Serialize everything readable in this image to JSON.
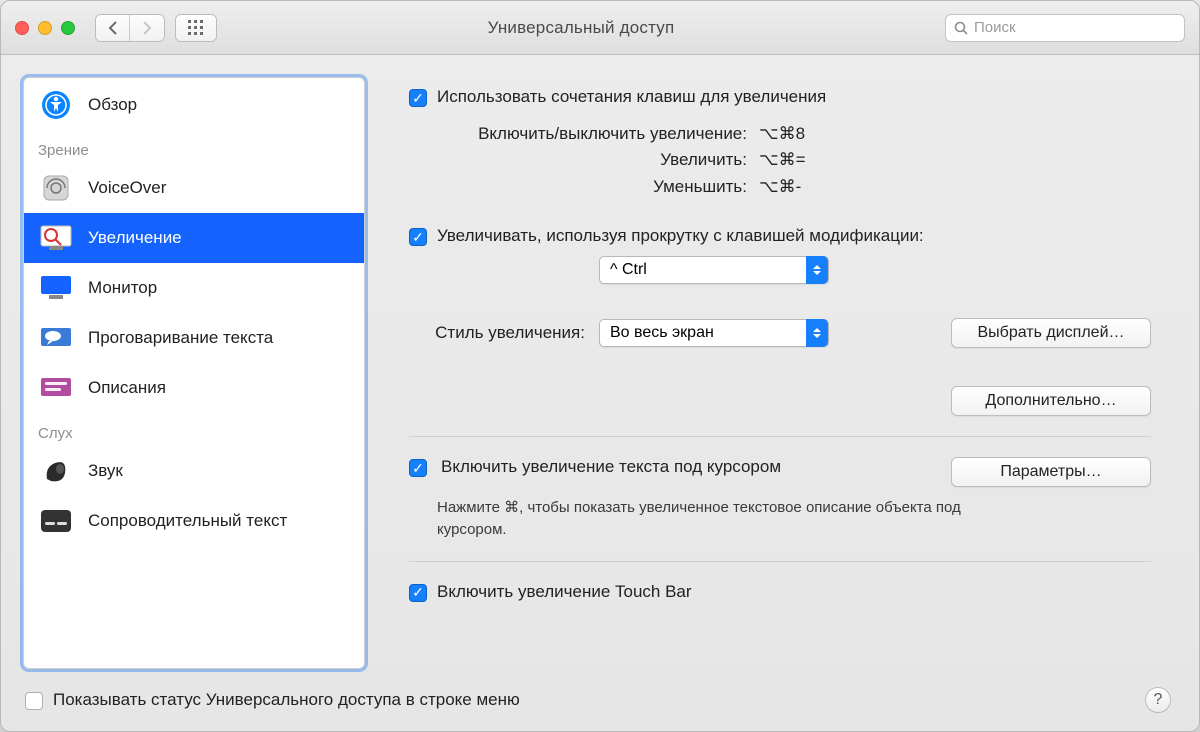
{
  "window": {
    "title": "Универсальный доступ"
  },
  "search": {
    "placeholder": "Поиск"
  },
  "sidebar": {
    "section_vision": "Зрение",
    "section_hearing": "Слух",
    "items": {
      "overview": "Обзор",
      "voiceover": "VoiceOver",
      "zoom": "Увеличение",
      "display": "Монитор",
      "speech": "Проговаривание текста",
      "descriptions": "Описания",
      "audio": "Звук",
      "captions": "Сопроводительный текст"
    }
  },
  "zoom": {
    "use_shortcuts": "Использовать сочетания клавиш для увеличения",
    "shortcuts": {
      "toggle_label": "Включить/выключить увеличение:",
      "toggle_keys": "⌥⌘8",
      "zoom_in_label": "Увеличить:",
      "zoom_in_keys": "⌥⌘=",
      "zoom_out_label": "Уменьшить:",
      "zoom_out_keys": "⌥⌘-"
    },
    "scroll_modifier": "Увеличивать, используя прокрутку с клавишей модификации:",
    "modifier_value": "^ Ctrl",
    "style_label": "Стиль увеличения:",
    "style_value": "Во весь экран",
    "choose_display": "Выбрать дисплей…",
    "advanced": "Дополнительно…",
    "hover_text": "Включить увеличение текста под курсором",
    "hover_hint": "Нажмите ⌘, чтобы показать увеличенное текстовое описание объекта под курсором.",
    "options": "Параметры…",
    "touchbar": "Включить увеличение Touch Bar"
  },
  "footer": {
    "show_status": "Показывать статус Универсального доступа в строке меню"
  }
}
